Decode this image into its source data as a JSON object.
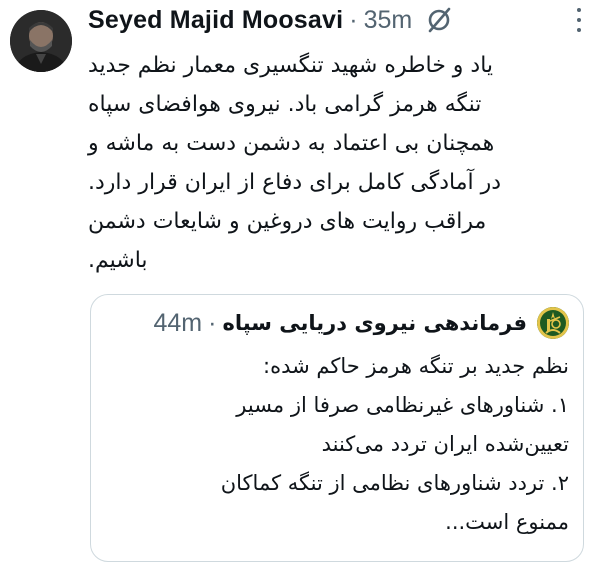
{
  "post": {
    "author_name": "Seyed Majid Moosavi",
    "separator": "·",
    "time": "35m",
    "grok_icon": "grok-slash-icon",
    "menu_icon": "more-dots-icon",
    "avatar_icon": "profile-photo",
    "text_lines": [
      "یاد و خاطره شهید تنگسیری معمار نظم جدید",
      "تنگه هرمز گرامی باد. نیروی هوافضای سپاه",
      "همچنان بی اعتماد به دشمن دست به ماشه و",
      "در آمادگی کامل برای دفاع از ایران قرار دارد.",
      "مراقب روایت های دروغین و شایعات دشمن",
      "باشیم."
    ]
  },
  "quoted_post": {
    "author_name": "فرماندهی نیروی دریایی سپاه",
    "separator": "·",
    "time": "44m",
    "avatar_icon": "irgc-emblem-icon",
    "text_lines": [
      "نظم جدید بر تنگه هرمز حاکم شده:",
      "۱. شناورهای غیرنظامی صرفا از مسیر",
      "تعیین‌شده ایران تردد می‌کنند",
      "۲. تردد شناورهای نظامی از تنگه کماکان",
      "ممنوع است..."
    ]
  },
  "colors": {
    "text_primary": "#0f1419",
    "text_secondary": "#536471",
    "border": "#cfd9de",
    "emblem_green": "#1e5a22",
    "emblem_gold": "#e3c44a"
  }
}
